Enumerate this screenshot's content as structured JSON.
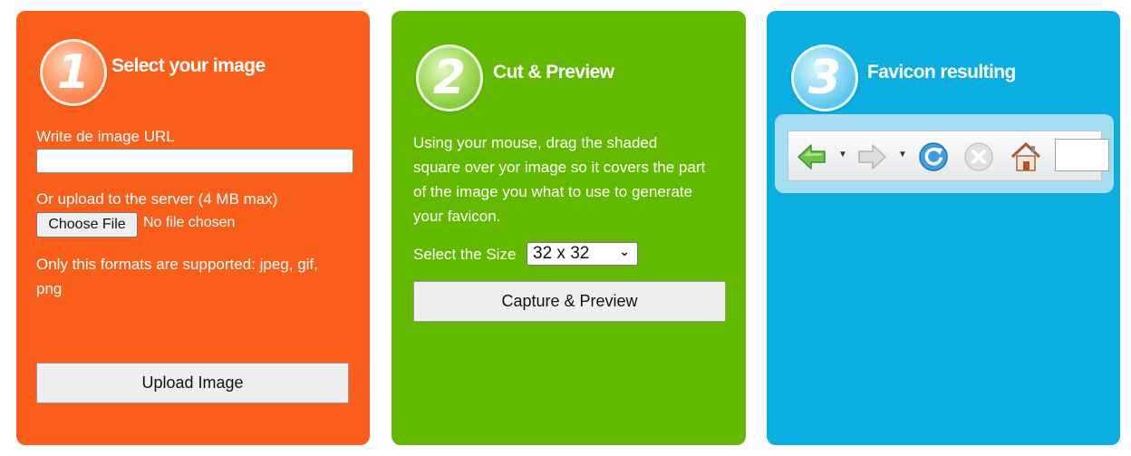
{
  "panel1": {
    "step": "1",
    "title": "Select your image",
    "url_label": "Write de image URL",
    "url_value": "",
    "upload_label": "Or upload to the server (4 MB max)",
    "choose_file_label": "Choose File",
    "file_status": "No file chosen",
    "formats_line1": "Only this formats are supported: jpeg, gif,",
    "formats_line2": "png",
    "upload_button": "Upload Image"
  },
  "panel2": {
    "step": "2",
    "title": "Cut & Preview",
    "instructions": [
      "Using your mouse, drag the shaded",
      "square over yor image so it covers the part",
      "of the image you what to use to generate",
      "your favicon."
    ],
    "size_label": "Select the Size",
    "size_selected": "32 x 32",
    "capture_button": "Capture & Preview"
  },
  "panel3": {
    "step": "3",
    "title": "Favicon resulting",
    "toolbar_icons": [
      "back-arrow-icon",
      "forward-arrow-icon",
      "refresh-icon",
      "stop-icon",
      "home-icon"
    ]
  },
  "colors": {
    "panel1": "#f95f1a",
    "panel2": "#62b900",
    "panel3": "#0aaee0"
  }
}
